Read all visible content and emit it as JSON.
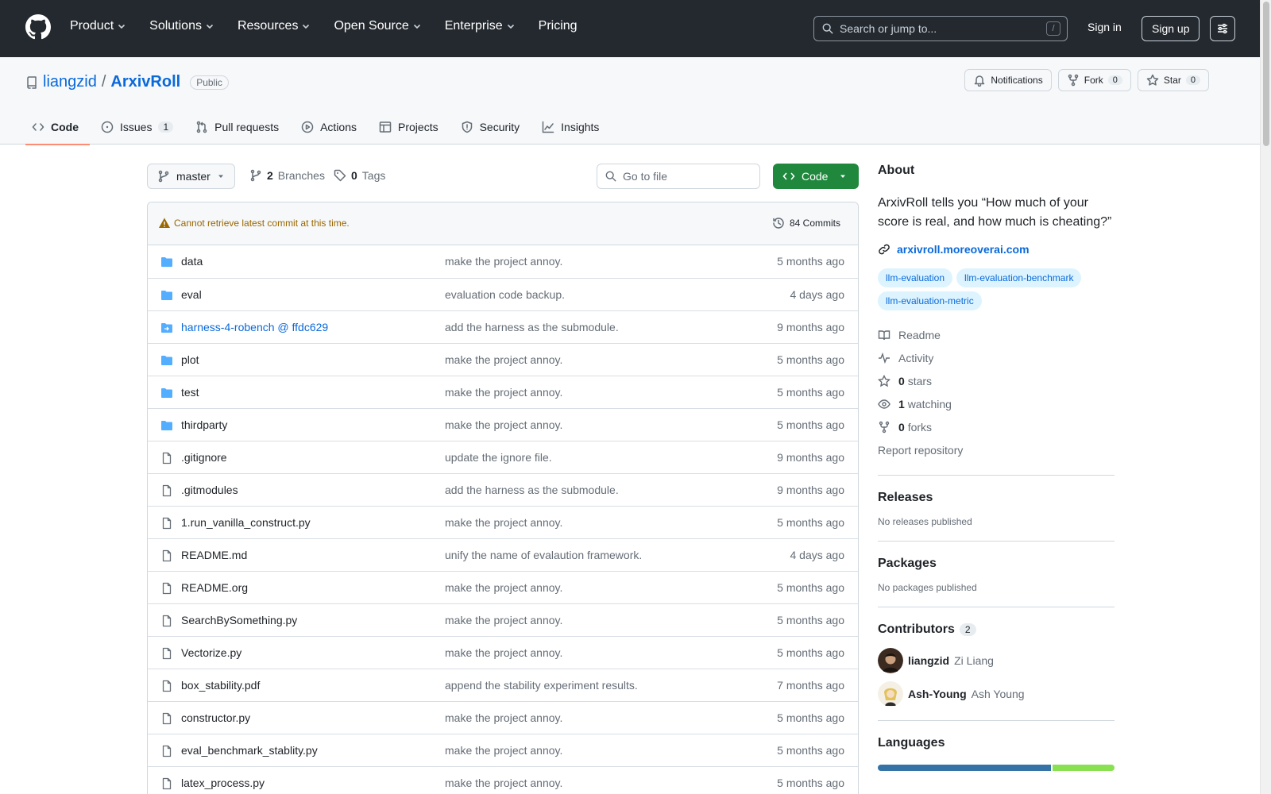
{
  "header": {
    "nav": [
      "Product",
      "Solutions",
      "Resources",
      "Open Source",
      "Enterprise",
      "Pricing"
    ],
    "search_placeholder": "Search or jump to...",
    "search_key": "/",
    "signin": "Sign in",
    "signup": "Sign up"
  },
  "repo": {
    "owner": "liangzid",
    "separator": "/",
    "name": "ArxivRoll",
    "visibility": "Public",
    "actions": {
      "notifications": "Notifications",
      "fork_label": "Fork",
      "fork_count": "0",
      "star_label": "Star",
      "star_count": "0"
    },
    "tabs": [
      {
        "label": "Code",
        "icon": "code-icon"
      },
      {
        "label": "Issues",
        "count": "1",
        "icon": "issue-icon"
      },
      {
        "label": "Pull requests",
        "icon": "pull-request-icon"
      },
      {
        "label": "Actions",
        "icon": "play-icon"
      },
      {
        "label": "Projects",
        "icon": "table-icon"
      },
      {
        "label": "Security",
        "icon": "shield-icon"
      },
      {
        "label": "Insights",
        "icon": "graph-icon"
      }
    ]
  },
  "browser": {
    "branch": "master",
    "branches_count": "2",
    "branches_label": "Branches",
    "tags_count": "0",
    "tags_label": "Tags",
    "goto_placeholder": "Go to file",
    "code_button": "Code",
    "commit_warning": "Cannot retrieve latest commit at this time.",
    "commits": "84 Commits",
    "files": [
      {
        "name": "data",
        "type": "dir",
        "message": "make the project annoy.",
        "time": "5 months ago"
      },
      {
        "name": "eval",
        "type": "dir",
        "message": "evaluation code backup.",
        "time": "4 days ago"
      },
      {
        "name": "harness-4-robench @ ffdc629",
        "type": "submodule",
        "message": "add the harness as the submodule.",
        "time": "9 months ago"
      },
      {
        "name": "plot",
        "type": "dir",
        "message": "make the project annoy.",
        "time": "5 months ago"
      },
      {
        "name": "test",
        "type": "dir",
        "message": "make the project annoy.",
        "time": "5 months ago"
      },
      {
        "name": "thirdparty",
        "type": "dir",
        "message": "make the project annoy.",
        "time": "5 months ago"
      },
      {
        "name": ".gitignore",
        "type": "file",
        "message": "update the ignore file.",
        "time": "9 months ago"
      },
      {
        "name": ".gitmodules",
        "type": "file",
        "message": "add the harness as the submodule.",
        "time": "9 months ago"
      },
      {
        "name": "1.run_vanilla_construct.py",
        "type": "file",
        "message": "make the project annoy.",
        "time": "5 months ago"
      },
      {
        "name": "README.md",
        "type": "file",
        "message": "unify the name of evalaution framework.",
        "time": "4 days ago"
      },
      {
        "name": "README.org",
        "type": "file",
        "message": "make the project annoy.",
        "time": "5 months ago"
      },
      {
        "name": "SearchBySomething.py",
        "type": "file",
        "message": "make the project annoy.",
        "time": "5 months ago"
      },
      {
        "name": "Vectorize.py",
        "type": "file",
        "message": "make the project annoy.",
        "time": "5 months ago"
      },
      {
        "name": "box_stability.pdf",
        "type": "file",
        "message": "append the stability experiment results.",
        "time": "7 months ago"
      },
      {
        "name": "constructor.py",
        "type": "file",
        "message": "make the project annoy.",
        "time": "5 months ago"
      },
      {
        "name": "eval_benchmark_stablity.py",
        "type": "file",
        "message": "make the project annoy.",
        "time": "5 months ago"
      },
      {
        "name": "latex_process.py",
        "type": "file",
        "message": "make the project annoy.",
        "time": "5 months ago"
      }
    ]
  },
  "sidebar": {
    "about_title": "About",
    "description": "ArxivRoll tells you “How much of your score is real, and how much is cheating?”",
    "website": "arxivroll.moreoverai.com",
    "topics": [
      "llm-evaluation",
      "llm-evaluation-benchmark",
      "llm-evaluation-metric"
    ],
    "readme": "Readme",
    "activity": "Activity",
    "stars_count": "0",
    "stars_label": "stars",
    "watching_count": "1",
    "watching_label": "watching",
    "forks_count": "0",
    "forks_label": "forks",
    "report": "Report repository",
    "releases_title": "Releases",
    "releases_text": "No releases published",
    "packages_title": "Packages",
    "packages_text": "No packages published",
    "contributors_title": "Contributors",
    "contributors_count": "2",
    "contributors": [
      {
        "login": "liangzid",
        "name": "Zi Liang"
      },
      {
        "login": "Ash-Young",
        "name": "Ash Young"
      }
    ],
    "languages_title": "Languages"
  },
  "colors": {
    "header_bg": "#24292f",
    "link": "#0969da",
    "primary_button": "#1f883d",
    "active_tab_underline": "#fd8c73",
    "folder": "#54aeff",
    "warning": "#9a6700"
  }
}
